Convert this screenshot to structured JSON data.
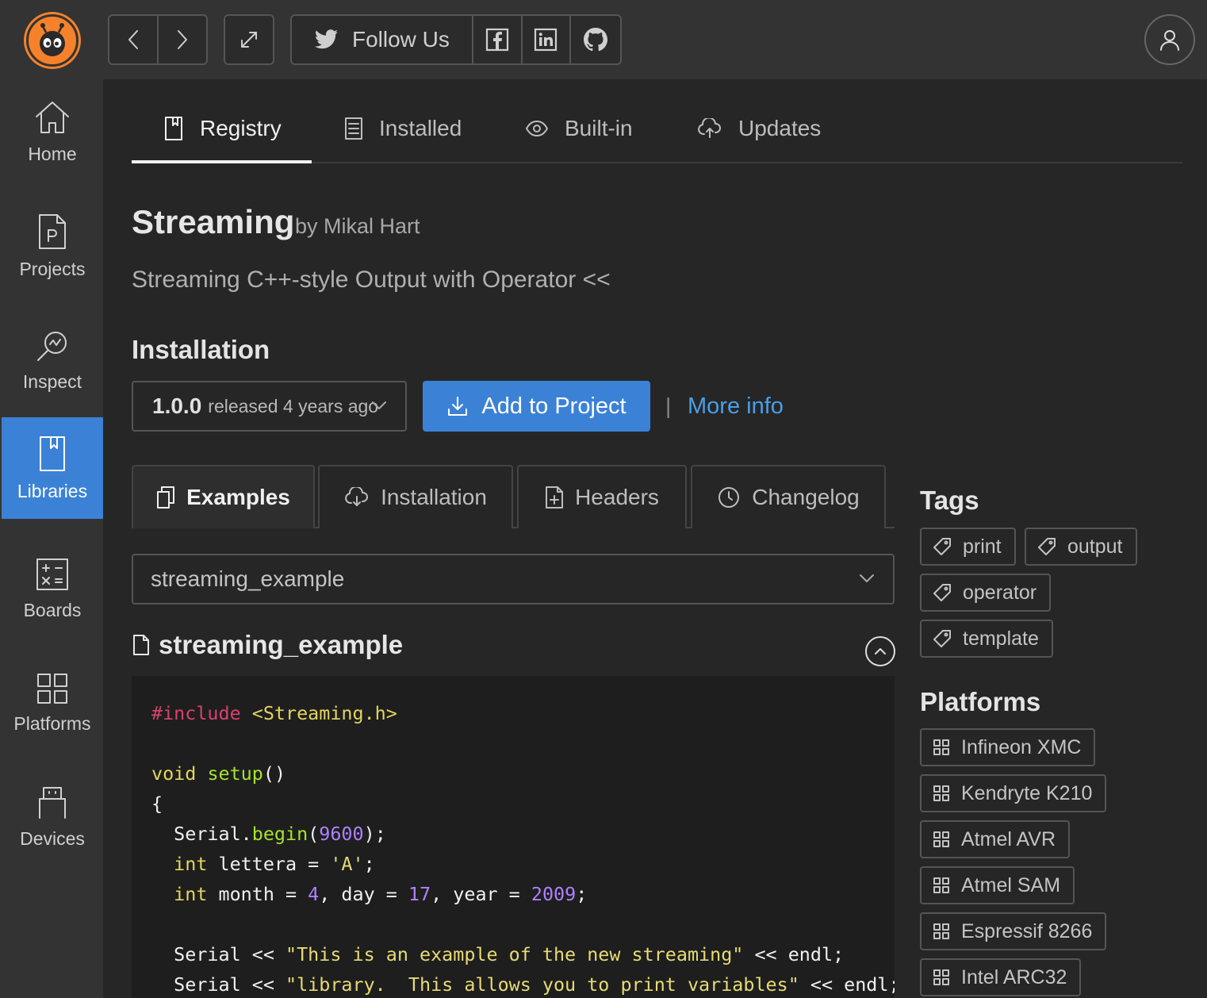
{
  "topbar": {
    "back_label": "<",
    "forward_label": ">",
    "follow_label": "Follow Us"
  },
  "sidebar": {
    "items": [
      {
        "label": "Home",
        "icon": "home-icon"
      },
      {
        "label": "Projects",
        "icon": "project-file-icon"
      },
      {
        "label": "Inspect",
        "icon": "inspect-icon"
      },
      {
        "label": "Libraries",
        "icon": "libraries-icon",
        "active": true
      },
      {
        "label": "Boards",
        "icon": "boards-icon"
      },
      {
        "label": "Platforms",
        "icon": "platforms-icon"
      },
      {
        "label": "Devices",
        "icon": "devices-icon"
      }
    ]
  },
  "tabs": [
    {
      "label": "Registry",
      "icon": "registry-icon",
      "active": true
    },
    {
      "label": "Installed",
      "icon": "installed-icon"
    },
    {
      "label": "Built-in",
      "icon": "eye-icon"
    },
    {
      "label": "Updates",
      "icon": "cloud-upload-icon"
    }
  ],
  "library": {
    "name": "Streaming",
    "author": "by Mikal Hart",
    "description": "Streaming C++-style Output with Operator <<"
  },
  "installation": {
    "heading": "Installation",
    "version": "1.0.0",
    "released": "released 4 years ago",
    "add_button": "Add to Project",
    "separator": "|",
    "more_info": "More info"
  },
  "subtabs": [
    {
      "label": "Examples",
      "icon": "copy-icon",
      "active": true
    },
    {
      "label": "Installation",
      "icon": "cloud-download-icon"
    },
    {
      "label": "Headers",
      "icon": "file-plus-icon"
    },
    {
      "label": "Changelog",
      "icon": "clock-icon"
    }
  ],
  "examples": {
    "selected": "streaming_example",
    "heading": "streaming_example"
  },
  "tags": {
    "heading": "Tags",
    "items": [
      "print",
      "output",
      "operator",
      "template"
    ]
  },
  "platforms": {
    "heading": "Platforms",
    "items": [
      "Infineon XMC",
      "Kendryte K210",
      "Atmel AVR",
      "Atmel SAM",
      "Espressif 8266",
      "Intel ARC32"
    ]
  },
  "colors": {
    "accent": "#3b82d6",
    "link": "#4a9ee8",
    "logo": "#f5822a"
  }
}
